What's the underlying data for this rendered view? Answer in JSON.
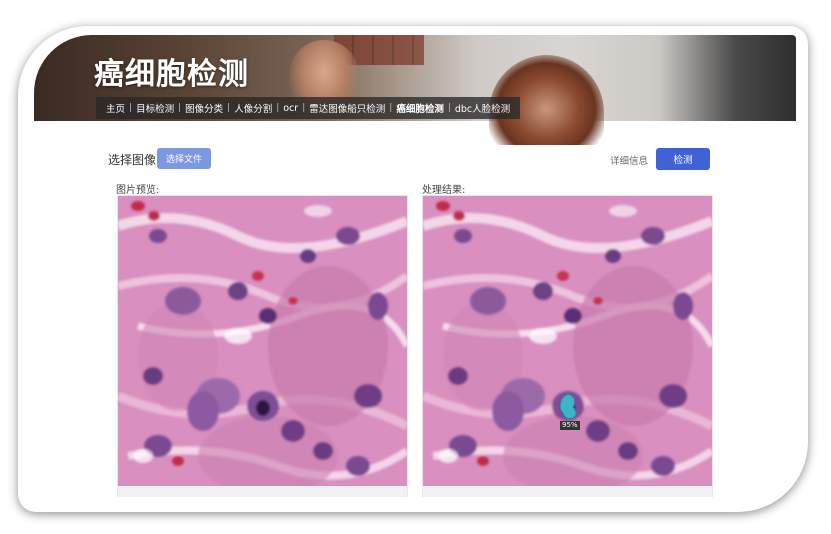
{
  "header": {
    "title": "癌细胞检测",
    "nav": [
      {
        "label": "主页",
        "active": false
      },
      {
        "label": "目标检测",
        "active": false
      },
      {
        "label": "图像分类",
        "active": false
      },
      {
        "label": "人像分割",
        "active": false
      },
      {
        "label": "ocr",
        "active": false
      },
      {
        "label": "雷达图像船只检测",
        "active": false
      },
      {
        "label": "癌细胞检测",
        "active": true
      },
      {
        "label": "dbc人脸检测",
        "active": false
      }
    ]
  },
  "toolbar": {
    "select_image_label": "选择图像",
    "choose_file_button": "选择文件",
    "details_link": "详细信息",
    "detect_button": "检测"
  },
  "preview": {
    "label": "图片预览:"
  },
  "result": {
    "label": "处理结果:",
    "detection": {
      "confidence_label": "95%",
      "color": "#3fb3c9"
    }
  },
  "colors": {
    "primary_button": "#3f63d6",
    "secondary_button": "#7d97e3"
  }
}
